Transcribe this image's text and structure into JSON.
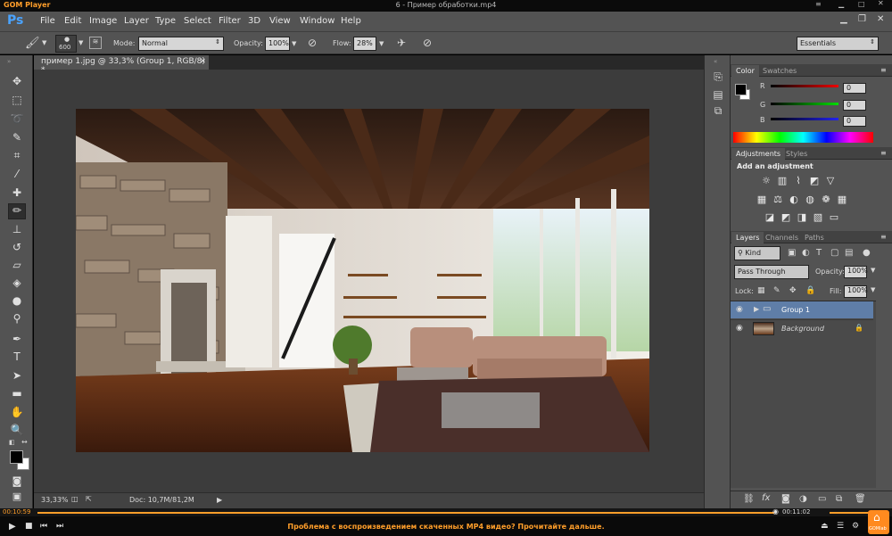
{
  "gom": {
    "logo": "GOM Player",
    "file_title": "6 - Пример обработки.mp4",
    "time_elapsed": "00:10:59",
    "time_total": "00:11:02",
    "message": "Проблема с воспроизведением скаченных MP4 видео? Прочитайте дальше.",
    "brand": "GOMlab"
  },
  "menu": [
    "File",
    "Edit",
    "Image",
    "Layer",
    "Type",
    "Select",
    "Filter",
    "3D",
    "View",
    "Window",
    "Help"
  ],
  "ps_logo": "Ps",
  "options": {
    "brush_size": "600",
    "mode_label": "Mode:",
    "mode_value": "Normal",
    "opacity_label": "Opacity:",
    "opacity_value": "100%",
    "flow_label": "Flow:",
    "flow_value": "28%",
    "workspace": "Essentials"
  },
  "document": {
    "tab_title": "пример 1.jpg @ 33,3% (Group 1, RGB/8) *",
    "zoom": "33,33%",
    "doc_info": "Doc: 10,7M/81,2M"
  },
  "color_panel": {
    "tabs": [
      "Color",
      "Swatches"
    ],
    "r_label": "R",
    "g_label": "G",
    "b_label": "B",
    "r": "0",
    "g": "0",
    "b": "0"
  },
  "adjustments_panel": {
    "tabs": [
      "Adjustments",
      "Styles"
    ],
    "heading": "Add an adjustment"
  },
  "layers_panel": {
    "tabs": [
      "Layers",
      "Channels",
      "Paths"
    ],
    "kind": "Kind",
    "blend_mode": "Pass Through",
    "opacity_label": "Opacity:",
    "opacity": "100%",
    "lock_label": "Lock:",
    "fill_label": "Fill:",
    "fill": "100%",
    "layers": [
      {
        "name": "Group 1"
      },
      {
        "name": "Background"
      }
    ]
  },
  "colors": {
    "accent": "#ff9e2a",
    "ps_blue": "#4aa3ff",
    "panel": "#535353"
  }
}
